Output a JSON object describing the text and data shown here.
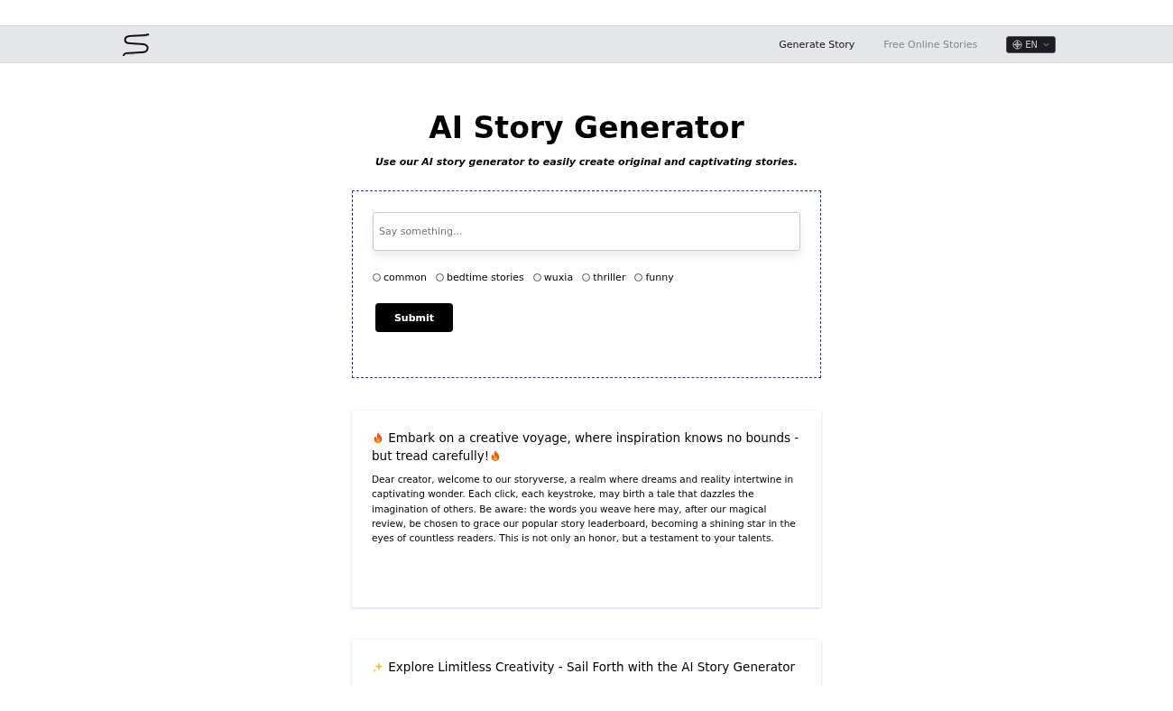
{
  "nav": {
    "links": [
      {
        "label": "Generate Story",
        "selected": true
      },
      {
        "label": "Free Online Stories",
        "selected": false
      }
    ],
    "language": "EN"
  },
  "hero": {
    "title": "AI Story Generator",
    "subtitle": "Use our AI story generator to easily create original and captivating stories."
  },
  "form": {
    "prompt": {
      "placeholder": "Say something..."
    },
    "genres": [
      {
        "label": "common",
        "selected": false
      },
      {
        "label": "bedtime stories",
        "selected": false
      },
      {
        "label": "wuxia",
        "selected": false
      },
      {
        "label": "thriller",
        "selected": false
      },
      {
        "label": "funny",
        "selected": false
      }
    ],
    "submit": "Submit"
  },
  "cards": [
    {
      "kind": "warning",
      "title": "Embark on a creative voyage, where inspiration knows no bounds - but tread carefully!",
      "body": "Dear creator, welcome to our storyverse, a realm where dreams and reality intertwine in captivating wonder. Each click, each keystroke, may birth a tale that dazzles the imagination of others. Be aware: the words you weave here may, after our magical review, be chosen to grace our popular story leaderboard, becoming a shining star in the eyes of countless readers. This is not only an honor, but a testament to your talents."
    },
    {
      "kind": "highlight",
      "title": "Explore Limitless Creativity - Sail Forth with the AI Story Generator"
    }
  ]
}
